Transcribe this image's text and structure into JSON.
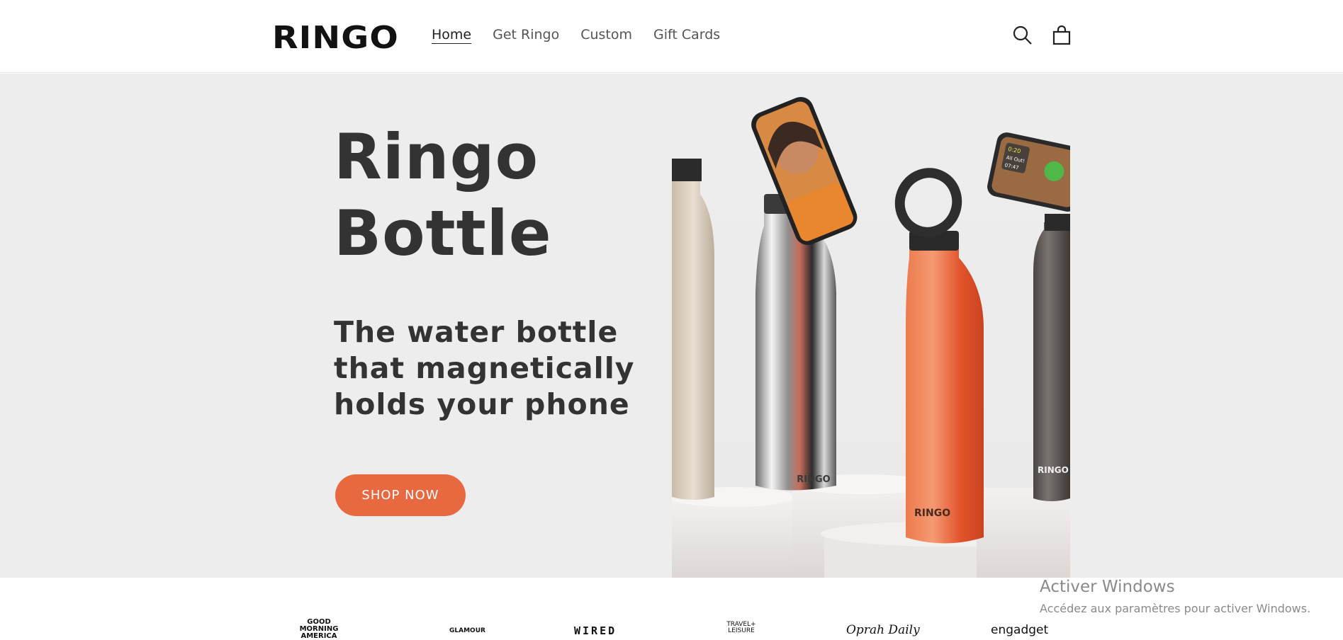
{
  "header": {
    "logo": "RINGO",
    "nav": [
      {
        "label": "Home",
        "active": true
      },
      {
        "label": "Get Ringo",
        "active": false
      },
      {
        "label": "Custom",
        "active": false
      },
      {
        "label": "Gift Cards",
        "active": false
      }
    ],
    "icons": {
      "search": "search-icon",
      "cart": "cart-icon"
    }
  },
  "hero": {
    "title_line1": "Ringo",
    "title_line2": "Bottle",
    "subtitle": "The water bottle that magnetically holds your phone",
    "cta": "SHOP NOW",
    "image_bottle_brand": "RINGO",
    "phone_screen_stats": [
      "0:20",
      "All Out!",
      "07:47"
    ]
  },
  "press": [
    "GOOD MORNING AMERICA",
    "GLAMOUR",
    "WIRED",
    "TRAVEL+ LEISURE",
    "Oprah Daily",
    "engadget"
  ],
  "watermark": {
    "title": "Activer Windows",
    "subtitle": "Accédez aux paramètres pour activer Windows."
  },
  "colors": {
    "accent": "#e8693f",
    "hero_bg": "#ededed",
    "text": "#333333"
  }
}
